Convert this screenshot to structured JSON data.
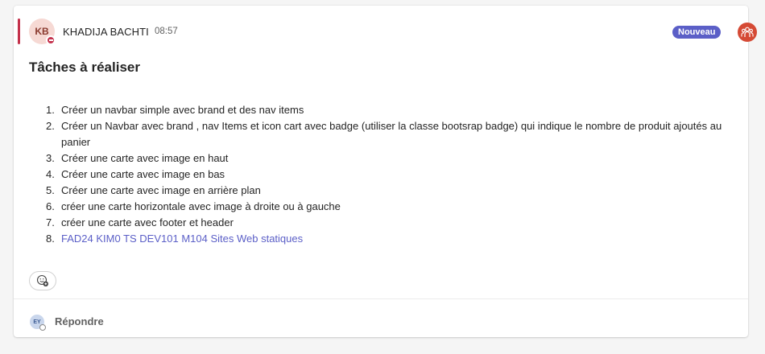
{
  "message": {
    "author_initials": "KB",
    "author_name": "KHADIJA BACHTI",
    "time": "08:57",
    "new_badge": "Nouveau",
    "title": "Tâches à réaliser",
    "tasks": [
      {
        "num": "1.",
        "text": "Créer un navbar simple avec brand et des nav items"
      },
      {
        "num": "2.",
        "text": "Créer un Navbar avec brand , nav Items et icon cart avec badge (utiliser la classe bootsrap badge) qui indique le nombre de produit ajoutés au panier"
      },
      {
        "num": "3.",
        "text": "Créer une carte avec image en haut"
      },
      {
        "num": "4.",
        "text": "Créer une carte avec image en bas"
      },
      {
        "num": "5.",
        "text": "Créer une carte avec image en arrière plan"
      },
      {
        "num": "6.",
        "text": "créer une carte horizontale avec image à droite ou à gauche"
      },
      {
        "num": "7.",
        "text": "créer une carte avec footer et header"
      },
      {
        "num": "8.",
        "text": "FAD24 KIM0 TS DEV101 M104 Sites Web statiques"
      }
    ]
  },
  "reply": {
    "avatar_initials": "EY",
    "label": "Répondre"
  },
  "colors": {
    "accent": "#c4314b",
    "brand": "#5b5fc7",
    "team_avatar": "#d54a35"
  },
  "icons": {
    "presence": "do-not-disturb-icon",
    "team": "team-avatar-icon",
    "reaction": "add-reaction-icon"
  }
}
